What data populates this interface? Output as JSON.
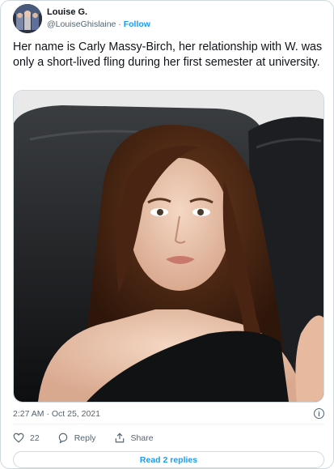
{
  "author": {
    "display_name": "Louise G.",
    "handle": "@LouiseGhislaine",
    "separator": "·",
    "follow_label": "Follow",
    "avatar_icon": "profile-photo"
  },
  "tweet": {
    "text": "Her name is Carly Massy-Birch, her relationship with W. was only a short-lived fling during her first semester at university.",
    "timestamp": "2:27 AM · Oct 25, 2021",
    "media_description_icon": "photo"
  },
  "actions": {
    "likes_count": "22",
    "reply_label": "Reply",
    "share_label": "Share"
  },
  "replies": {
    "read_label": "Read 2 replies"
  },
  "colors": {
    "accent": "#1d9bf0",
    "text_primary": "#0f1419",
    "text_secondary": "#536471",
    "border": "#cfd9de"
  }
}
